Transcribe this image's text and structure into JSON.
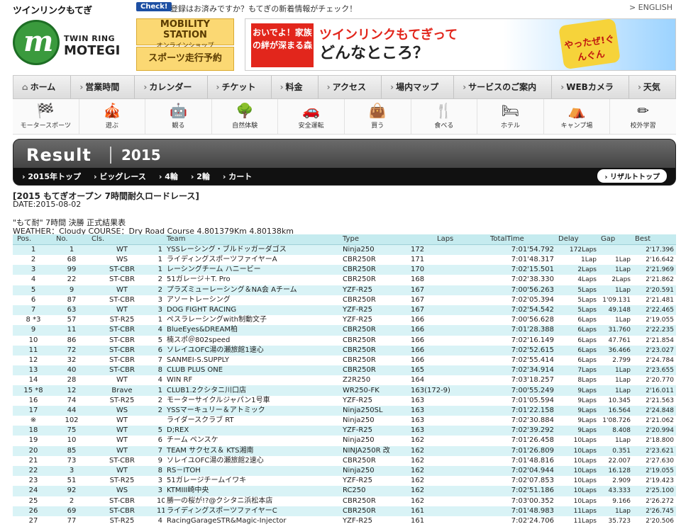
{
  "top": {
    "site_name": "ツインリンクもてぎ",
    "check_badge": "Check!",
    "check_text": "登録はお済みですか？もてぎの新着情報がチェック！",
    "english_link": "> ENGLISH"
  },
  "logo": {
    "line1": "TWIN RING",
    "line2": "MOTEGI"
  },
  "promos": {
    "mobility_big": "MOBILITY STATION",
    "mobility_small": "オンラインショップ",
    "sports_big": "スポーツ走行予約"
  },
  "banner": {
    "red_text": "おいでよ！家族の絆が深まる森",
    "main_line1": "ツインリンクもてぎって",
    "main_line2": "どんなところ？",
    "char_text": "やったぜ!ぐんぐん"
  },
  "nav": [
    "ホーム",
    "営業時間",
    "カレンダー",
    "チケット",
    "料金",
    "アクセス",
    "場内マップ",
    "サービスのご案内",
    "WEBカメラ",
    "天気"
  ],
  "categories": [
    {
      "label": "モータースポーツ",
      "icon": "checkered-flag-icon",
      "glyph": "🏁"
    },
    {
      "label": "遊ぶ",
      "icon": "mobipark-icon",
      "glyph": "🎪"
    },
    {
      "label": "観る",
      "icon": "robot-icon",
      "glyph": "🤖"
    },
    {
      "label": "自然体験",
      "icon": "hello-woods-icon",
      "glyph": "🌳"
    },
    {
      "label": "安全運転",
      "icon": "active-safety-icon",
      "glyph": "🚗"
    },
    {
      "label": "買う",
      "icon": "shopping-bag-icon",
      "glyph": "👜"
    },
    {
      "label": "食べる",
      "icon": "fork-knife-icon",
      "glyph": "🍴"
    },
    {
      "label": "ホテル",
      "icon": "bed-icon",
      "glyph": "🛏"
    },
    {
      "label": "キャンプ場",
      "icon": "tent-icon",
      "glyph": "⛺"
    },
    {
      "label": "校外学習",
      "icon": "pencil-icon",
      "glyph": "✏"
    }
  ],
  "result": {
    "title": "Result",
    "year": "2015",
    "links": [
      "2015年トップ",
      "ビッグレース",
      "4輪",
      "2輪",
      "カート"
    ],
    "top_link": "› リザルトトップ"
  },
  "race": {
    "title": "[2015 もてぎオープン 7時間耐久ロードレース]",
    "date": "DATE:2015-08-02",
    "subtitle": "\"もて耐\" 7時間 決勝 正式結果表",
    "weather": "WEATHER：Cloudy COURSE：Dry Road Course 4.801379Km 4.80138km"
  },
  "table": {
    "headers": [
      "Pos.",
      "No.",
      "Cls.",
      "",
      "Team",
      "Type",
      "Laps",
      "TotalTime",
      "Delay",
      "Gap",
      "Best"
    ],
    "rows": [
      [
        "1",
        "1",
        "WT",
        "1",
        "YSSレーシング・ブルドッガーダゴス",
        "Ninja250",
        "172",
        "7:01'54.792",
        "172Laps",
        "",
        "2'17.396"
      ],
      [
        "2",
        "68",
        "WS",
        "1",
        "ライディングスポーツファイヤーA",
        "CBR250R",
        "171",
        "7:01'48.317",
        "1Lap",
        "1Lap",
        "2'16.642"
      ],
      [
        "3",
        "99",
        "ST-CBR",
        "1",
        "レーシングチーム ハニービー",
        "CBR250R",
        "170",
        "7:02'15.501",
        "2Laps",
        "1Lap",
        "2'21.969"
      ],
      [
        "4",
        "22",
        "ST-CBR",
        "2",
        "51ガレージ＋T. Pro",
        "CBR250R",
        "168",
        "7:02'38.330",
        "4Laps",
        "2Laps",
        "2'21.862"
      ],
      [
        "5",
        "9",
        "WT",
        "2",
        "プラズミューレーシング＆NA会 Aチーム",
        "YZF-R25",
        "167",
        "7:00'56.263",
        "5Laps",
        "1Lap",
        "2'20.591"
      ],
      [
        "6",
        "87",
        "ST-CBR",
        "3",
        "アソートレーシング",
        "CBR250R",
        "167",
        "7:02'05.394",
        "5Laps",
        "1'09.131",
        "2'21.481"
      ],
      [
        "7",
        "63",
        "WT",
        "3",
        "DOG FIGHT RACING",
        "YZF-R25",
        "167",
        "7:02'54.542",
        "5Laps",
        "49.148",
        "2'22.465"
      ],
      [
        "8 *3",
        "57",
        "ST-R25",
        "1",
        "ぺスラレーシングwith制動文子",
        "YZF-R25",
        "166",
        "7:00'56.628",
        "6Laps",
        "1Lap",
        "2'19.055"
      ],
      [
        "9",
        "11",
        "ST-CBR",
        "4",
        "BlueEyes&DREAM柏",
        "CBR250R",
        "166",
        "7:01'28.388",
        "6Laps",
        "31.760",
        "2'22.235"
      ],
      [
        "10",
        "86",
        "ST-CBR",
        "5",
        "楠スポ＠802speed",
        "CBR250R",
        "166",
        "7:02'16.149",
        "6Laps",
        "47.761",
        "2'21.854"
      ],
      [
        "11",
        "72",
        "ST-CBR",
        "6",
        "ソレイユOFC湯の瀬旅館1速心",
        "CBR250R",
        "166",
        "7:02'52.615",
        "6Laps",
        "36.466",
        "2'23.027"
      ],
      [
        "12",
        "32",
        "ST-CBR",
        "7",
        "SANMEI-S.SUPPLY",
        "CBR250R",
        "166",
        "7:02'55.414",
        "6Laps",
        "2.799",
        "2'24.784"
      ],
      [
        "13",
        "40",
        "ST-CBR",
        "8",
        "CLUB PLUS ONE",
        "CBR250R",
        "165",
        "7:02'34.914",
        "7Laps",
        "1Lap",
        "2'23.655"
      ],
      [
        "14",
        "28",
        "WT",
        "4",
        "WIN RF",
        "Z2R250",
        "164",
        "7:03'18.257",
        "8Laps",
        "1Lap",
        "2'20.770"
      ],
      [
        "15 *8",
        "12",
        "Brave",
        "1",
        "CLUB1.2クシタニ川口店",
        "WR250-FK",
        "163(172-9)",
        "7:00'55.249",
        "9Laps",
        "1Lap",
        "2'16.011"
      ],
      [
        "16",
        "74",
        "ST-R25",
        "2",
        "モーターサイクルジャパン1号車",
        "YZF-R25",
        "163",
        "7:01'05.594",
        "9Laps",
        "10.345",
        "2'21.563"
      ],
      [
        "17",
        "44",
        "WS",
        "2",
        "YSSマーキュリー＆アトミック",
        "Ninja250SL",
        "163",
        "7:01'22.158",
        "9Laps",
        "16.564",
        "2'24.848"
      ],
      [
        "※",
        "102",
        "WT",
        "",
        "ライダースクラブ RT",
        "Ninja250",
        "163",
        "7:02'30.884",
        "9Laps",
        "1'08.726",
        "2'21.062"
      ],
      [
        "18",
        "75",
        "WT",
        "5",
        "D;REX",
        "YZF-R25",
        "163",
        "7:02'39.292",
        "9Laps",
        "8.408",
        "2'20.994"
      ],
      [
        "19",
        "10",
        "WT",
        "6",
        "チーム ペンスケ",
        "Ninja250",
        "162",
        "7:01'26.458",
        "10Laps",
        "1Lap",
        "2'18.800"
      ],
      [
        "20",
        "85",
        "WT",
        "7",
        "TEAM サクセス＆ KTS湘南",
        "NINJA250R 改",
        "162",
        "7:01'26.809",
        "10Laps",
        "0.351",
        "2'23.621"
      ],
      [
        "21",
        "73",
        "ST-CBR",
        "9",
        "ソレイユOFC湯の瀬旅館2速心",
        "CBR250R",
        "162",
        "7:01'48.816",
        "10Laps",
        "22.007",
        "2'27.630"
      ],
      [
        "22",
        "3",
        "WT",
        "8",
        "RS－ITOH",
        "Ninja250",
        "162",
        "7:02'04.944",
        "10Laps",
        "16.128",
        "2'19.055"
      ],
      [
        "23",
        "51",
        "ST-R25",
        "3",
        "51ガレージチームイワキ",
        "YZF-R25",
        "162",
        "7:02'07.853",
        "10Laps",
        "2.909",
        "2'19.423"
      ],
      [
        "24",
        "92",
        "WS",
        "3",
        "KTMIII崎中央",
        "RC250",
        "162",
        "7:02'51.186",
        "10Laps",
        "43.333",
        "2'25.100"
      ],
      [
        "25",
        "2",
        "ST-CBR",
        "10",
        "勝一の桜が!?@クシタニ浜松本店",
        "CBR250R",
        "162",
        "7:03'00.352",
        "10Laps",
        "9.166",
        "2'26.272"
      ],
      [
        "26",
        "69",
        "ST-CBR",
        "11",
        "ライディングスポーツファイヤーC",
        "CBR250R",
        "161",
        "7:01'48.983",
        "11Laps",
        "1Lap",
        "2'26.745"
      ],
      [
        "27",
        "77",
        "ST-R25",
        "4",
        "RacingGarageSTR&Magic-Injector",
        "YZF-R25",
        "161",
        "7:02'24.706",
        "11Laps",
        "35.723",
        "2'20.506"
      ]
    ]
  },
  "colors": {
    "row_alt": "#d9f3f6",
    "header_bg": "#c5ebef",
    "nav_bg": "#e6e6e6",
    "result_bg": "#333333"
  }
}
